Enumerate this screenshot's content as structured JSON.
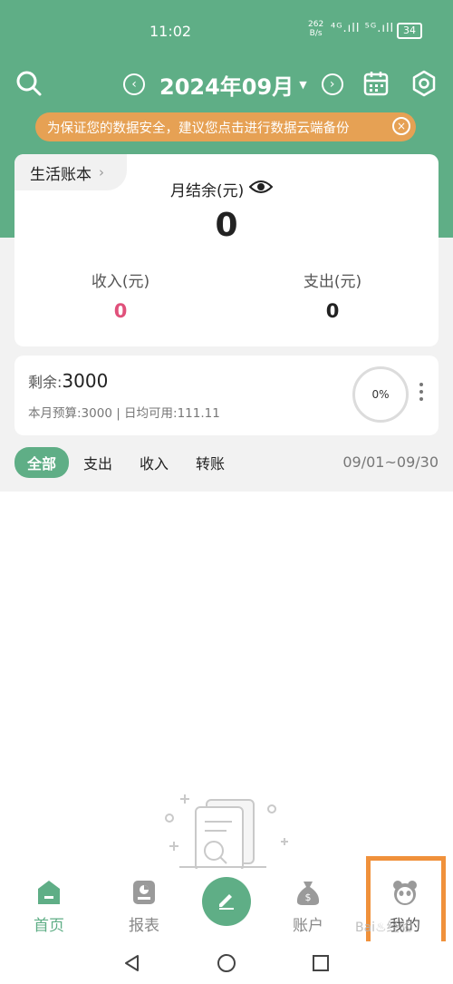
{
  "status_bar": {
    "time": "11:02",
    "net_speed": "262",
    "net_unit": "B/s",
    "signal": "⁴ᴳ.ıll ⁵ᴳ.ıll",
    "battery": "34"
  },
  "header": {
    "month": "2024年09月",
    "prev_icon": "chevron-left-circle",
    "next_icon": "chevron-right-circle"
  },
  "banner": {
    "text": "为保证您的数据安全，建议您点击进行数据云端备份",
    "close": "×"
  },
  "summary": {
    "book_name": "生活账本",
    "book_chevron": "›",
    "balance_label": "月结余(元)",
    "balance_value": "0",
    "income_label": "收入(元)",
    "income_value": "0",
    "expense_label": "支出(元)",
    "expense_value": "0"
  },
  "budget": {
    "remaining_label": "剩余:",
    "remaining_value": "3000",
    "detail": "本月预算:3000 | 日均可用:111.11",
    "progress": "0%"
  },
  "filters": {
    "items": [
      "全部",
      "支出",
      "收入",
      "转账"
    ],
    "active": "全部",
    "date_range": "09/01~09/30"
  },
  "tabbar": {
    "tabs": [
      "首页",
      "报表",
      "",
      "账户",
      "我的"
    ],
    "active": "首页"
  },
  "watermark": "Bai♨经验",
  "colors": {
    "primary": "#5fae86",
    "banner": "#e6a154",
    "income": "#e0517b",
    "highlight": "#f0913b"
  }
}
